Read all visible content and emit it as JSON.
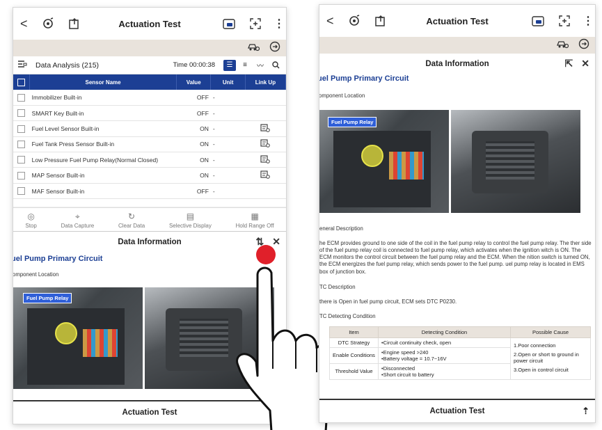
{
  "app": {
    "title": "Actuation Test",
    "back_glyph": "<",
    "kebab_glyph": "⋮",
    "footer_title": "Actuation Test"
  },
  "data_analysis": {
    "title": "Data Analysis (215)",
    "time": "Time 00:00:38",
    "columns": [
      "Sensor Name",
      "Value",
      "Unit",
      "Link Up"
    ],
    "rows": [
      {
        "name": "Immobilizer Built-in",
        "value": "OFF",
        "unit": "-",
        "link": false
      },
      {
        "name": "SMART Key Built-in",
        "value": "OFF",
        "unit": "-",
        "link": false
      },
      {
        "name": "Fuel Level Sensor Built-in",
        "value": "ON",
        "unit": "-",
        "link": true
      },
      {
        "name": "Fuel Tank Press Sensor Built-in",
        "value": "ON",
        "unit": "-",
        "link": true
      },
      {
        "name": "Low Pressure Fuel Pump Relay(Normal Closed)",
        "value": "ON",
        "unit": "-",
        "link": true
      },
      {
        "name": "MAP Sensor Built-in",
        "value": "ON",
        "unit": "-",
        "link": true
      },
      {
        "name": "MAF Sensor Built-in",
        "value": "OFF",
        "unit": "-",
        "link": false
      }
    ]
  },
  "toolbar": {
    "stop": "Stop",
    "data_capture": "Data Capture",
    "clear_data": "Clear Data",
    "selective_display": "Selective Display",
    "hold_range": "Hold Range Off"
  },
  "data_info": {
    "header": "Data Information",
    "section_title": "uel Pump Primary Circuit",
    "component_location": "omponent Location",
    "photo_tag": "Fuel Pump Relay",
    "general_title": "eneral Description",
    "general_text": "he ECM provides ground to one side of the coil in the fuel pump relay to control the fuel pump relay. The ther side of the fuel pump relay coil is connected to fuel pump relay, which activates when the ignition witch is ON. The ECM monitors the control circuit between the fuel pump relay and the ECM. When the nition switch is turned ON, the ECM energizes the fuel pump relay, which sends power to the fuel pump. uel pump relay is located in EMS box of junction box.",
    "dtc_title": "TC Description",
    "dtc_text": "there is Open in fuel pump circuit, ECM sets DTC P0230.",
    "detecting_title": "TC Detecting Condition",
    "table_headers": [
      "Item",
      "Detecting Condition",
      "Possible Cause"
    ],
    "table_rows": [
      {
        "item": "DTC Strategy",
        "cond": "•Circuit continuity check, open"
      },
      {
        "item": "Enable Conditions",
        "cond": "•Engine speed >240\n•Battery voltage = 10.7~16V"
      },
      {
        "item": "Threshold Value",
        "cond": "•Disconnected\n•Short circuit to battery"
      }
    ],
    "causes": [
      "1.Poor connection",
      "2.Open or short to ground in power circuit",
      "3.Open in control circuit"
    ]
  },
  "colors": {
    "accent": "#1c3f94",
    "band": "#e9e3dc",
    "touch": "#e0202a"
  }
}
